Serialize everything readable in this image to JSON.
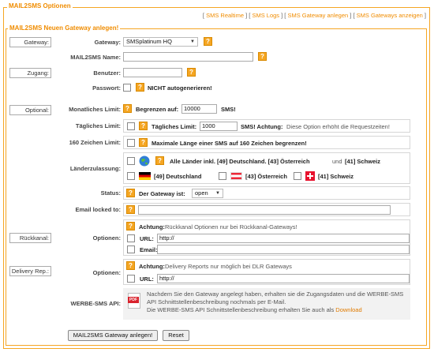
{
  "outer": {
    "legend": "MAIL2SMS Optionen"
  },
  "toplinks": [
    {
      "label": "SMS Realtime"
    },
    {
      "label": "SMS Logs"
    },
    {
      "label": "SMS Gateway anlegen"
    },
    {
      "label": "SMS Gateways anzeigen"
    }
  ],
  "inner": {
    "legend": "MAIL2SMS Neuen Gateway anlegen!"
  },
  "sections": {
    "gateway": "Gateway:",
    "zugang": "Zugang:",
    "optional": "Optional:",
    "rueckkanal": "Rückkanal:",
    "delivery": "Delivery Rep.:"
  },
  "fields": {
    "gateway": {
      "label": "Gateway:",
      "value": "SMSplatinum HQ"
    },
    "name": {
      "label": "MAIL2SMS Name:",
      "value": ""
    },
    "benutzer": {
      "label": "Benutzer:",
      "value": ""
    },
    "passwort": {
      "label": "Passwort:",
      "text": "NICHT autogenerieren!"
    },
    "monatlich": {
      "label": "Monatliches Limit:",
      "prefix": "Begrenzen auf:",
      "value": "10000",
      "suffix": "SMS!"
    },
    "taeglich": {
      "label": "Tägliches Limit:",
      "prefix": "Tägliches Limit:",
      "value": "1000",
      "suffix": "SMS! Achtung:",
      "note": "Diese Option erhöht die Requestzeiten!"
    },
    "zeichen": {
      "label": "160 Zeichen Limit:",
      "text": "Maximale Länge einer SMS auf 160 Zeichen begrenzen!"
    },
    "laender": {
      "label": "Länderzulassung:",
      "all_text": "Alle Länder inkl. [49] Deutschland. [43] Österreich",
      "und": "und",
      "ch_text": "[41] Schweiz",
      "de": "[49] Deutschland",
      "at": "[43] Österreich",
      "ch": "[41] Schweiz"
    },
    "status": {
      "label": "Status:",
      "prefix": "Der Gateway ist:",
      "value": "open"
    },
    "email_locked": {
      "label": "Email locked to:",
      "value": ""
    },
    "optionen_rk": {
      "label": "Optionen:",
      "achtung": "Achtung:",
      "note": "Rückkanal Optionen nur bei Rückkanal-Gateways!",
      "url_label": "URL:",
      "url_value": "http://",
      "email_label": "Email:",
      "email_value": ""
    },
    "optionen_dlr": {
      "label": "Optionen:",
      "achtung": "Achtung:",
      "note": "Delivery Reports nur möglich bei DLR Gateways",
      "url_label": "URL:",
      "url_value": "http://"
    },
    "werbe": {
      "label": "WERBE-SMS API:",
      "line1": "Nachdem Sie den Gateway angelegt haben, erhalten sie die Zugangsdaten und die WERBE-SMS",
      "line2": "API Schnittstellenbeschreibung nochmals per E-Mail.",
      "line3": "Die WERBE-SMS API Schnittstellenbeschreibung erhalten Sie auch als",
      "download": "Download",
      "pdf": "PDF"
    }
  },
  "buttons": {
    "submit": "MAIL2SMS Gateway anlegen!",
    "reset": "Reset"
  },
  "help_glyph": "?",
  "colors": {
    "accent": "#f5a623",
    "link": "#e07b00"
  }
}
